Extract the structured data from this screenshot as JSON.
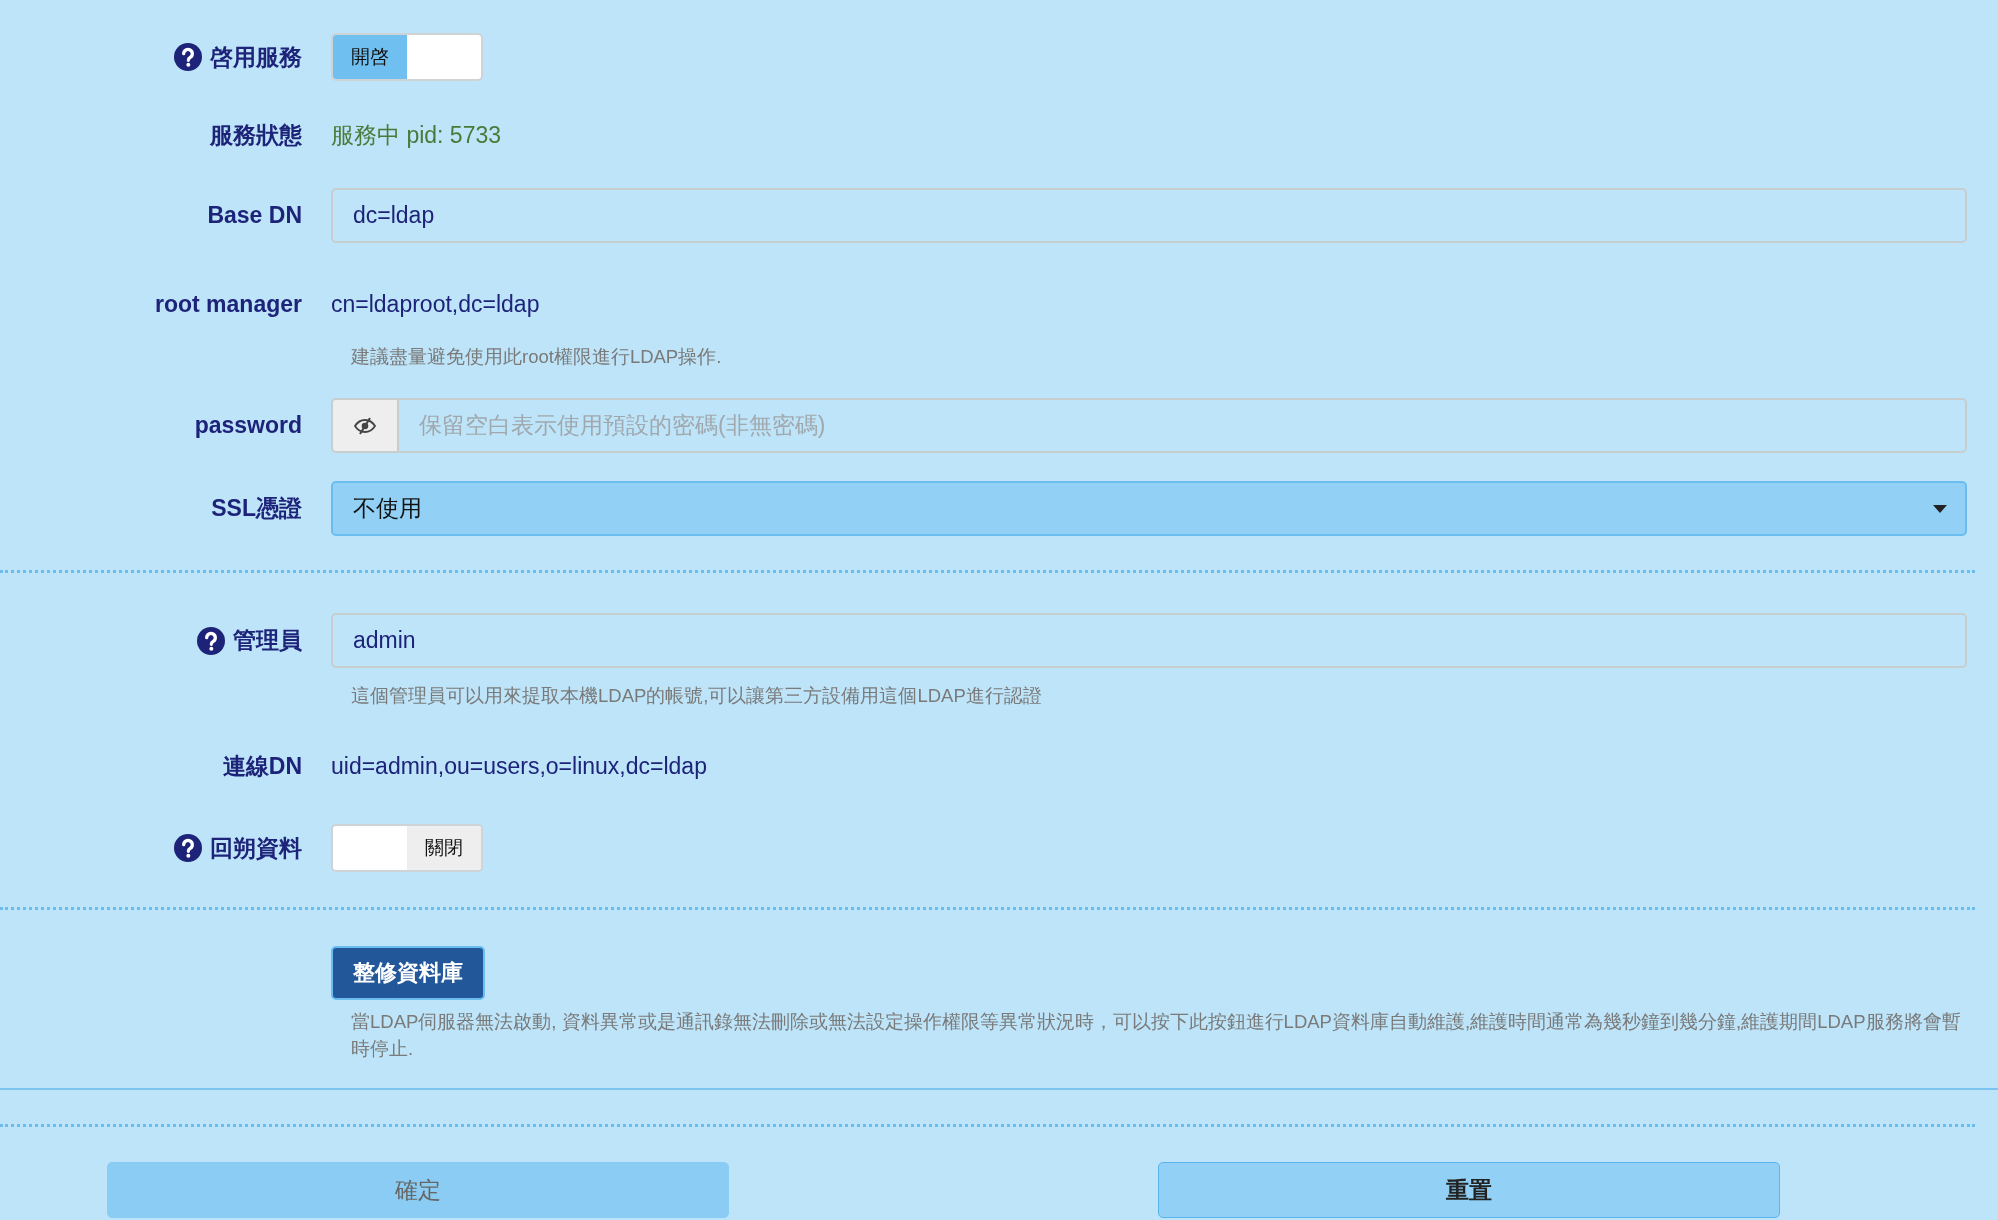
{
  "sections": [
    {
      "rows": [
        {
          "kind": "toggle",
          "label": "啓用服務",
          "help": true,
          "on": true,
          "state_text": "開啓"
        },
        {
          "kind": "status",
          "label": "服務狀態",
          "help": false,
          "value": "服務中 pid: 5733"
        },
        {
          "kind": "input",
          "label": "Base DN",
          "help": false,
          "value": "dc=ldap"
        },
        {
          "kind": "static",
          "label": "root manager",
          "help": false,
          "value": "cn=ldaproot,dc=ldap",
          "hint": "建議盡量避免使用此root權限進行LDAP操作."
        },
        {
          "kind": "password",
          "label": "password",
          "help": false,
          "placeholder": "保留空白表示使用預設的密碼(非無密碼)"
        },
        {
          "kind": "select",
          "label": "SSL憑證",
          "help": false,
          "value": "不使用"
        }
      ]
    },
    {
      "rows": [
        {
          "kind": "input",
          "label": "管理員",
          "help": true,
          "value": "admin",
          "hint": "這個管理員可以用來提取本機LDAP的帳號,可以讓第三方設備用這個LDAP進行認證"
        },
        {
          "kind": "static",
          "label": "連線DN",
          "help": false,
          "value": "uid=admin,ou=users,o=linux,dc=ldap"
        },
        {
          "kind": "toggle",
          "label": "回朔資料",
          "help": true,
          "on": false,
          "state_text": "關閉"
        }
      ]
    },
    {
      "rows": [
        {
          "kind": "action",
          "button": "整修資料庫",
          "hint": "當LDAP伺服器無法啟動, 資料異常或是通訊錄無法刪除或無法設定操作權限等異常狀況時，可以按下此按鈕進行LDAP資料庫自動維護,維護時間通常為幾秒鐘到幾分鐘,維護期間LDAP服務將會暫時停止."
        }
      ]
    }
  ],
  "buttons": [
    {
      "label": "確定",
      "disabled": true
    },
    {
      "label": "重置",
      "disabled": false
    }
  ]
}
